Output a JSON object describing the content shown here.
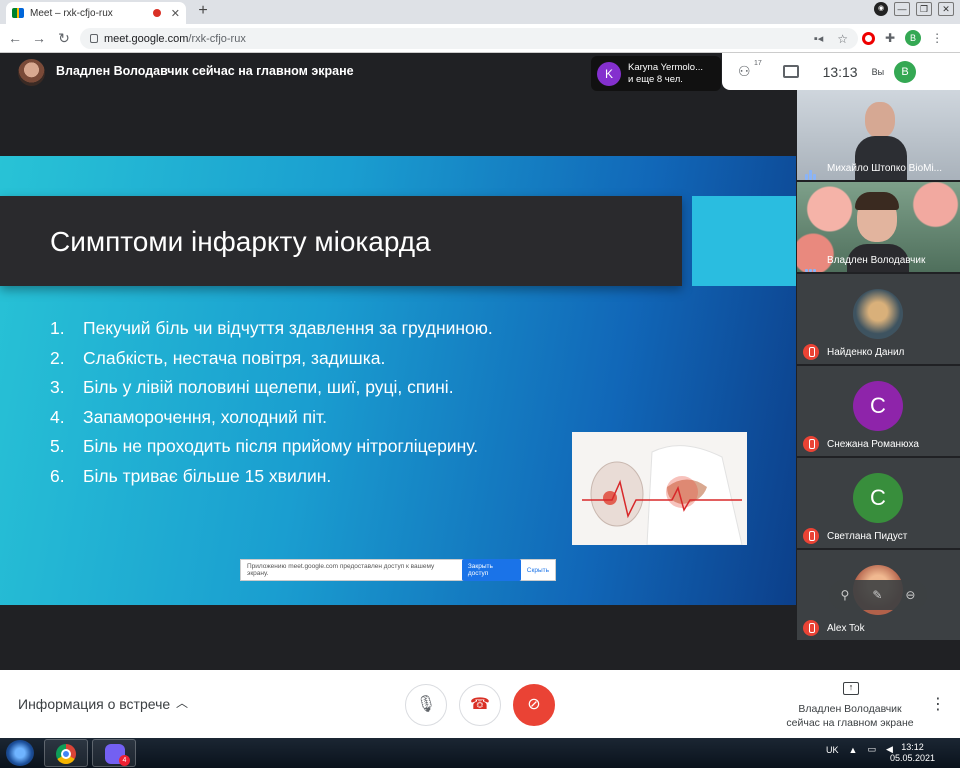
{
  "browser": {
    "tab_title": "Meet – rxk-cfjo-rux",
    "tab_close": "✕",
    "new_tab": "+",
    "url_host": "meet.google.com",
    "url_path": "/rxk-cfjo-rux",
    "profile_initial": "B",
    "win_media": "◉",
    "win_min": "—",
    "win_max": "❐",
    "win_close": "✕"
  },
  "meet": {
    "presenter_title": "Владлен Володавчик сейчас на главном экране",
    "notification": {
      "initial": "K",
      "line1": "Karyna Yermolo...",
      "line2": "и еще 8 чел."
    },
    "participants_count": "17",
    "time": "13:13",
    "you_label": "Вы",
    "user_initial": "B"
  },
  "slide": {
    "title": "Симптоми інфаркту міокарда",
    "items": [
      {
        "n": "1.",
        "text": "Пекучий біль чи відчуття здавлення за грудниною."
      },
      {
        "n": "2.",
        "text": "Слабкість, нестача повітря, задишка."
      },
      {
        "n": "3.",
        "text": "Біль у лівій половині щелепи, шиї, руці, спині."
      },
      {
        "n": "4.",
        "text": "Запаморочення, холодний піт."
      },
      {
        "n": "5.",
        "text": "Біль не проходить після прийому нітрогліцерину."
      },
      {
        "n": "6.",
        "text": "Біль триває більше 15 хвилин."
      }
    ],
    "share_bar": {
      "message": "Приложению meet.google.com предоставлен доступ к вашему экрану.",
      "stop_label": "Закрыть доступ",
      "hide_label": "Скрыть"
    }
  },
  "participants": [
    {
      "name": "Михайло Штопко ВіоМі...",
      "type": "video",
      "state": "speaking"
    },
    {
      "name": "Владлен Володавчик",
      "type": "video",
      "state": "speaking"
    },
    {
      "name": "Найденко Данил",
      "type": "photo",
      "state": "muted"
    },
    {
      "name": "Снежана Романюха",
      "type": "initial",
      "initial": "С",
      "color": "#8e24aa",
      "state": "muted"
    },
    {
      "name": "Светлана Пидуст",
      "type": "initial",
      "initial": "С",
      "color": "#388e3c",
      "state": "muted"
    },
    {
      "name": "Alex Tok",
      "type": "photo",
      "state": "muted"
    }
  ],
  "bottom": {
    "meeting_info": "Информация о встрече",
    "presenter_line1": "Владлен Володавчик",
    "presenter_line2": "сейчас на главном экране"
  },
  "taskbar": {
    "viber_badge": "4",
    "lang": "UK",
    "time": "13:12",
    "date": "05.05.2021"
  },
  "colors": {
    "end_call": "#d93025",
    "camera_off": "#ea4335",
    "slide_gradient_start": "#28c3d6",
    "slide_gradient_end": "#0c3f8a"
  }
}
